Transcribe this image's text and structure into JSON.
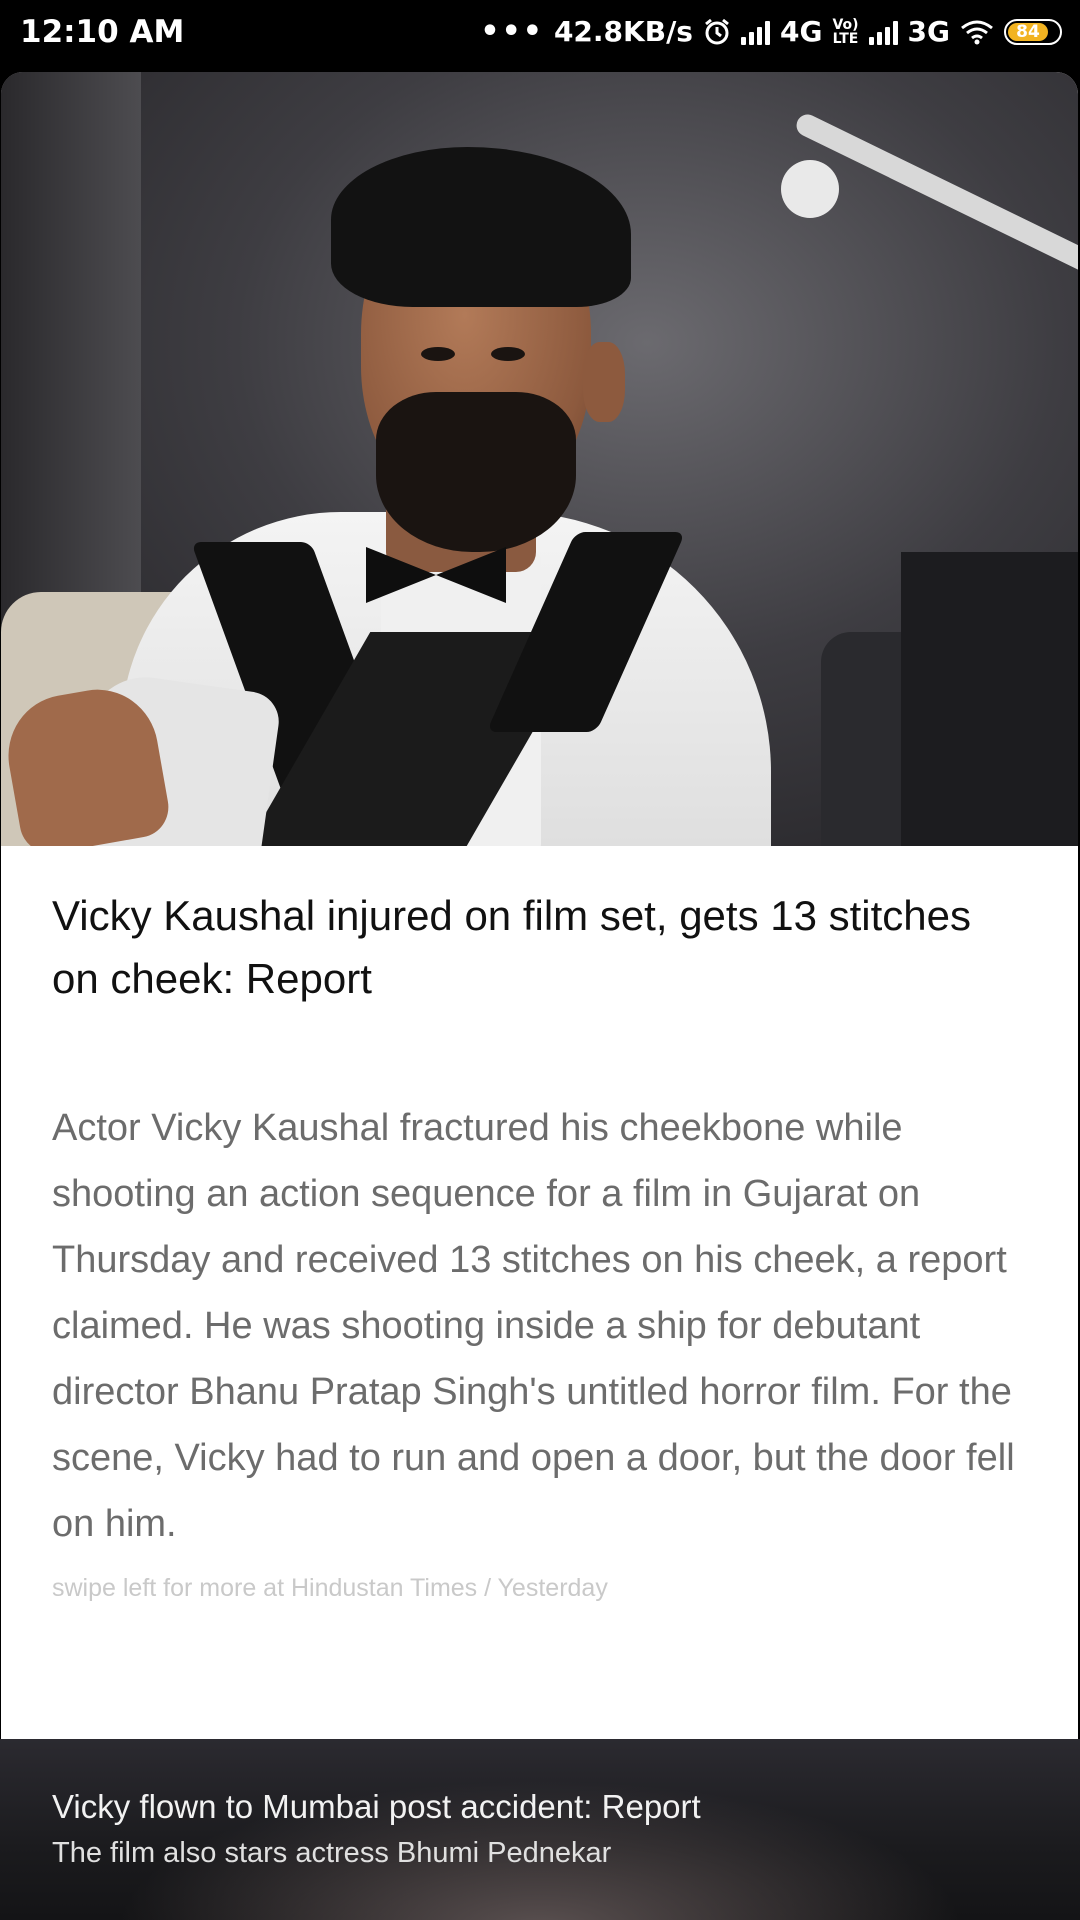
{
  "status_bar": {
    "time": "12:10 AM",
    "dots": "•••",
    "speed": "42.8KB/s",
    "alarm_icon": "alarm-icon",
    "net1": "4G",
    "volte_top": "Vo)",
    "volte_bottom": "LTE",
    "net2": "3G",
    "battery_level": "84",
    "battery_color": "#f2b321"
  },
  "article": {
    "headline": "Vicky Kaushal injured on film set, gets 13 stitches on cheek: Report",
    "summary": "Actor Vicky Kaushal fractured his cheekbone while shooting an action sequence for a film in Gujarat on Thursday and received 13 stitches on his cheek, a report claimed. He was shooting inside a ship for debutant director Bhanu Pratap Singh's untitled horror film. For the scene, Vicky had to run and open a door, but the door fell on him.",
    "source_line": "swipe left for more at Hindustan Times / Yesterday"
  },
  "bottom_card": {
    "title": "Vicky flown to Mumbai post accident: Report",
    "subtitle": "The film also stars actress Bhumi Pednekar"
  }
}
